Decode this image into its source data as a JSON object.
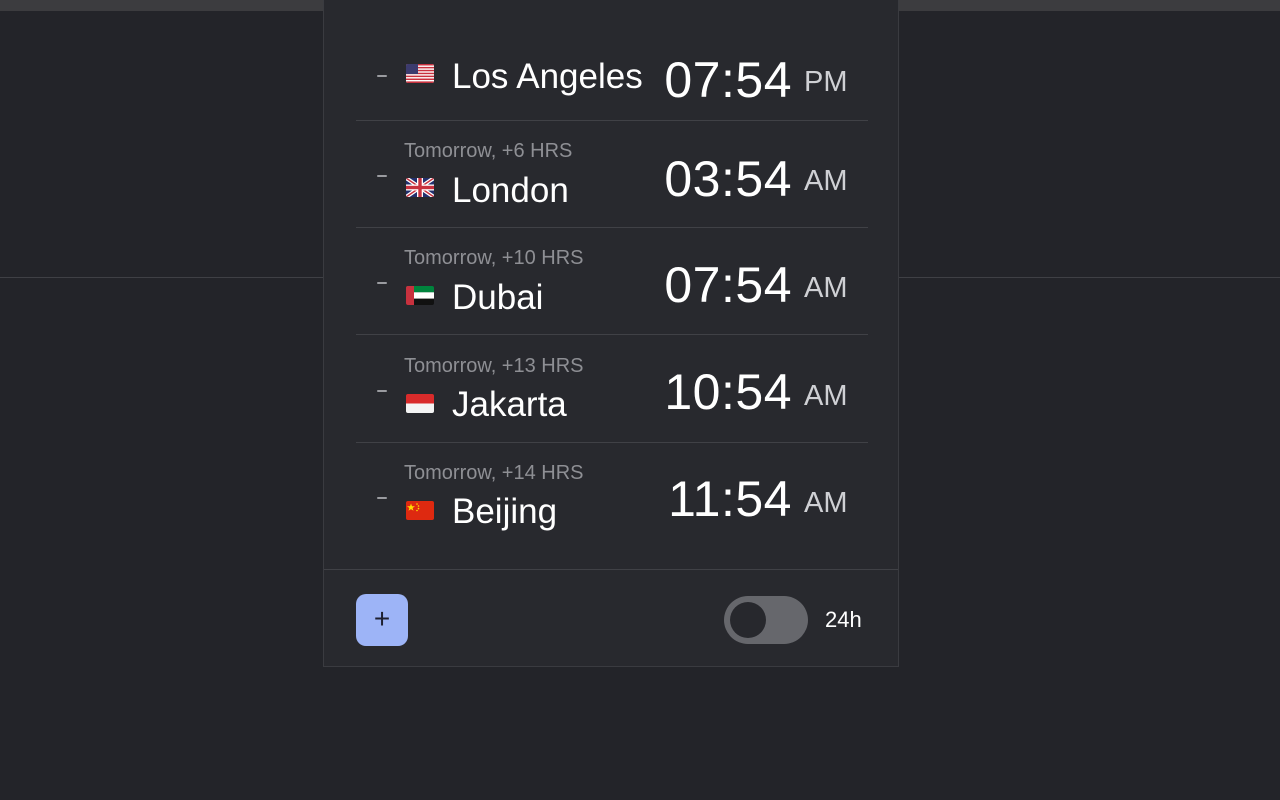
{
  "cities": [
    {
      "subtitle": "",
      "flag": "us-flag-icon",
      "city": "Los Angeles",
      "time": "07:54",
      "ampm": "PM"
    },
    {
      "subtitle": "Tomorrow, +6 HRS",
      "flag": "gb-flag-icon",
      "city": "London",
      "time": "03:54",
      "ampm": "AM"
    },
    {
      "subtitle": "Tomorrow, +10 HRS",
      "flag": "ae-flag-icon",
      "city": "Dubai",
      "time": "07:54",
      "ampm": "AM"
    },
    {
      "subtitle": "Tomorrow, +13 HRS",
      "flag": "id-flag-icon",
      "city": "Jakarta",
      "time": "10:54",
      "ampm": "AM"
    },
    {
      "subtitle": "Tomorrow, +14 HRS",
      "flag": "cn-flag-icon",
      "city": "Beijing",
      "time": "11:54",
      "ampm": "AM"
    }
  ],
  "remove_label": "-",
  "footer": {
    "add_label": "+",
    "toggle_label": "24h",
    "toggle_on": false
  },
  "colors": {
    "background": "#232429",
    "panel": "#28292e",
    "accent": "#9db4f7",
    "toggle_off": "#66676c"
  }
}
